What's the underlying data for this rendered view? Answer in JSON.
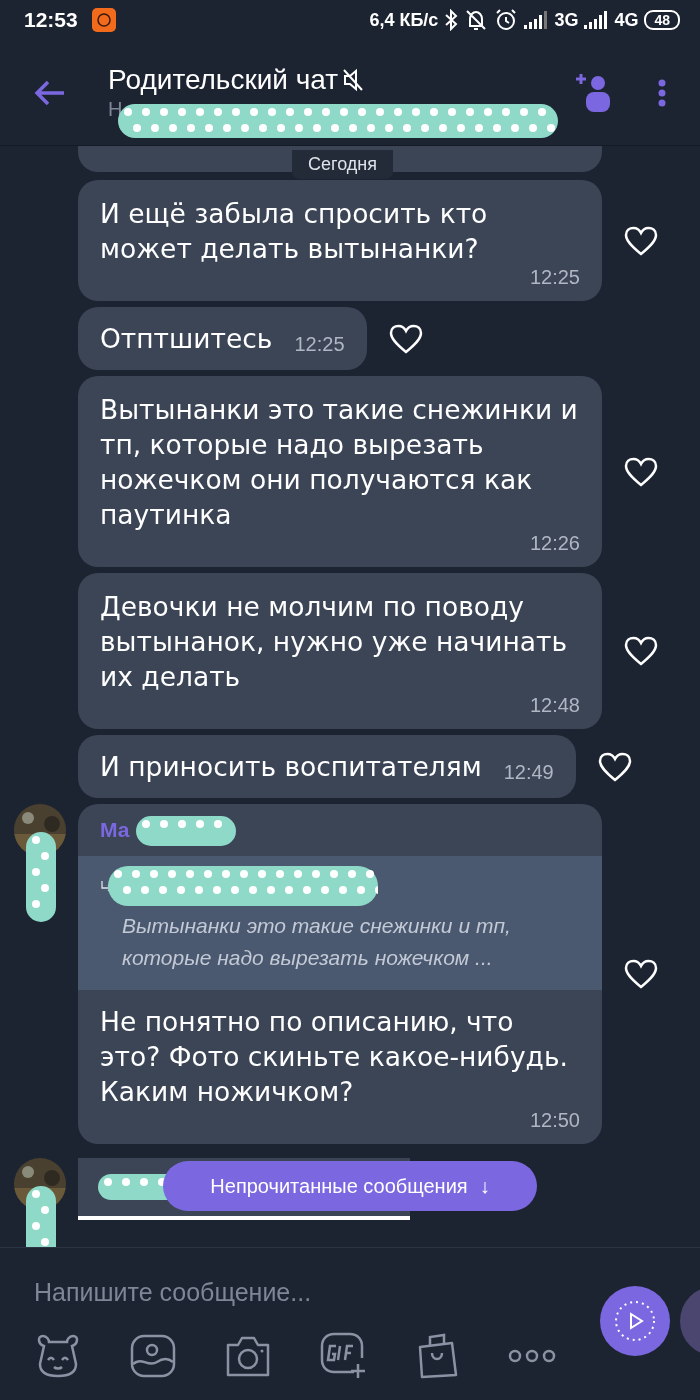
{
  "status_bar": {
    "time": "12:53",
    "speed": "6,4 КБ/с",
    "network_1": "3G",
    "network_2": "4G",
    "battery": "48"
  },
  "header": {
    "title": "Родительский чат",
    "muted": true,
    "subtitle": "Н"
  },
  "date_label": "Сегодня",
  "messages": [
    {
      "kind": "long",
      "text": "И ещё забыла спросить кто может делать вытынанки?",
      "time": "12:25"
    },
    {
      "kind": "short",
      "text": "Отптшитесь",
      "time": "12:25"
    },
    {
      "kind": "long",
      "text": "Вытынанки это такие снежинки и тп, которые надо вырезать ножечком они получаются как паутинка",
      "time": "12:26"
    },
    {
      "kind": "long",
      "text": "Девочки не молчим по поводу вытынанок, нужно уже начинать их делать",
      "time": "12:48"
    },
    {
      "kind": "short",
      "text": "И приносить воспитателям",
      "time": "12:49"
    },
    {
      "kind": "reply",
      "sender": "Ма",
      "quote": "Вытынанки это такие снежинки и тп, которые надо вырезать ножечком ...",
      "text": "Не понятно по описанию, что это? Фото скиньте какое-нибудь. Каким ножичком?",
      "time": "12:50"
    },
    {
      "kind": "partial"
    }
  ],
  "unread_button": {
    "label": "Непрочитанные сообщения",
    "arrow": "↓"
  },
  "composer": {
    "placeholder": "Напишите сообщение..."
  }
}
